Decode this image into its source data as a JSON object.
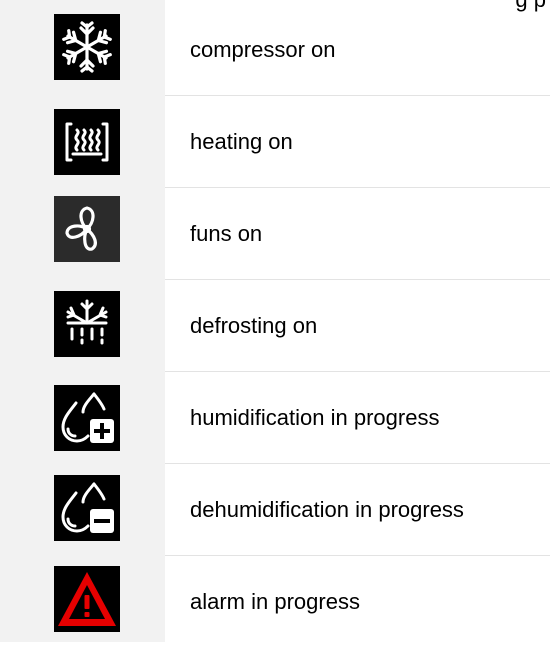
{
  "header_fragment": "g  p",
  "rows": [
    {
      "icon": "snowflake-icon",
      "label": "compressor on"
    },
    {
      "icon": "heater-icon",
      "label": "heating on"
    },
    {
      "icon": "fan-icon",
      "label": "funs on"
    },
    {
      "icon": "defrost-icon",
      "label": "defrosting on"
    },
    {
      "icon": "humidification-icon",
      "label": "humidification in progress"
    },
    {
      "icon": "dehumidification-icon",
      "label": "dehumidification in progress"
    },
    {
      "icon": "alarm-icon",
      "label": "alarm in progress"
    }
  ],
  "colors": {
    "alarm_red": "#e60000",
    "icon_bg": "#000000",
    "column_bg": "#f2f2f2"
  }
}
